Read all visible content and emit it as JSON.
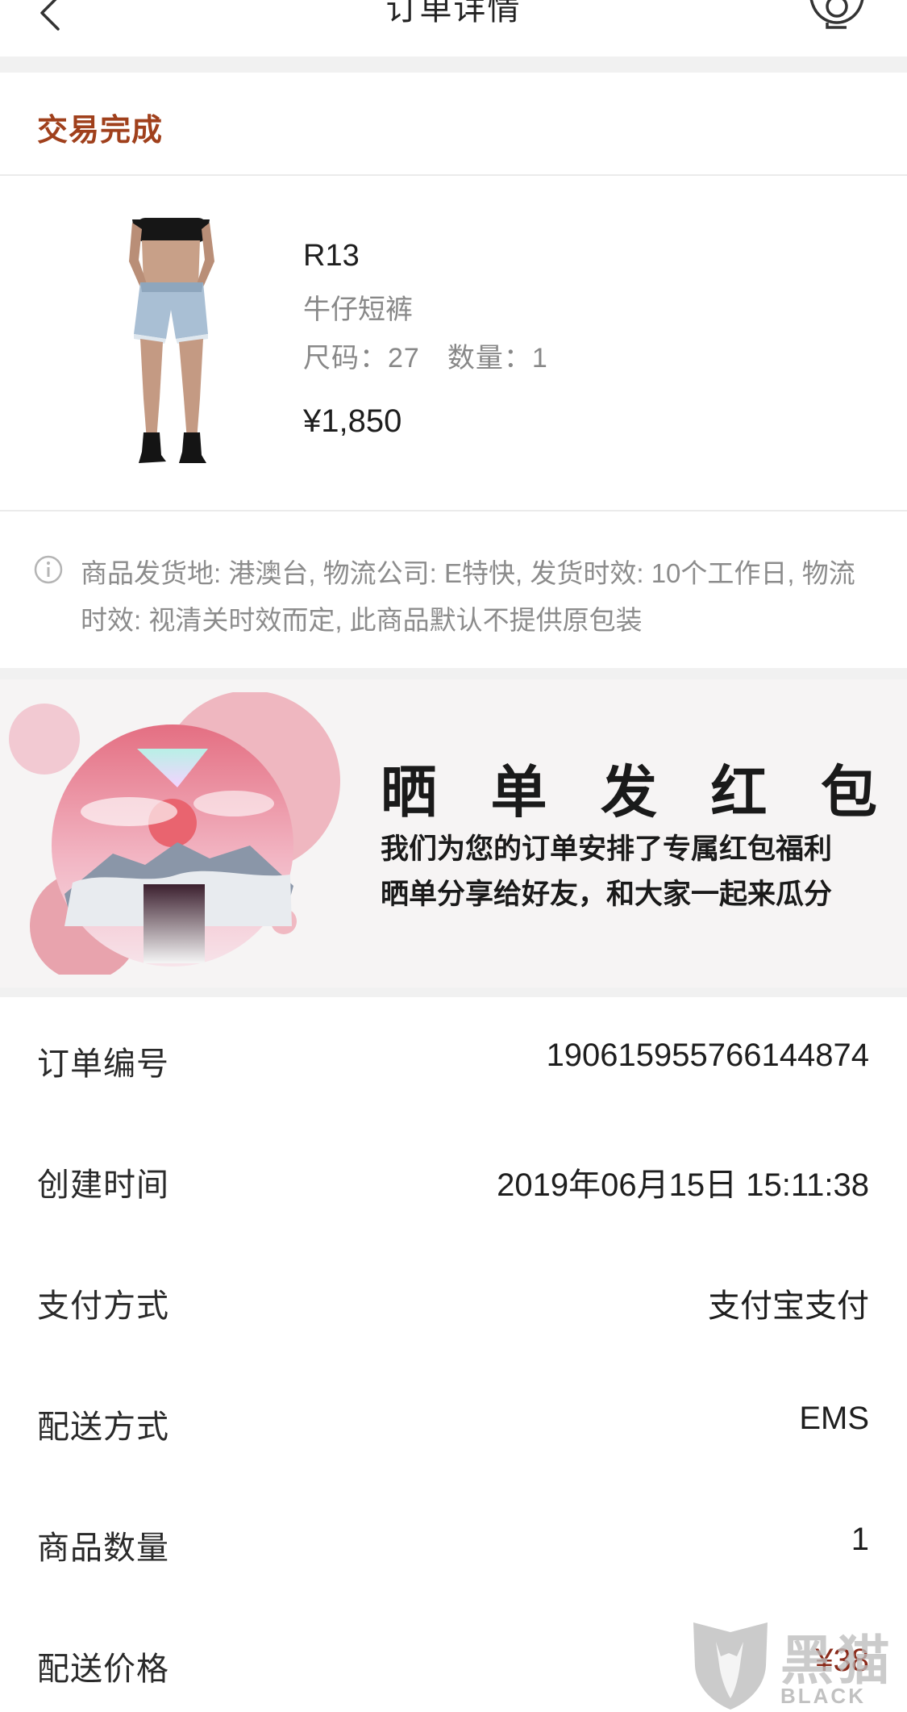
{
  "header": {
    "title": "订单详情"
  },
  "order_status": "交易完成",
  "product": {
    "brand": "R13",
    "name": "牛仔短裤",
    "size_label": "尺码：",
    "size_value": "27",
    "qty_label": "数量：",
    "qty_value": "1",
    "price": "¥1,850"
  },
  "notice": {
    "text": "商品发货地: 港澳台, 物流公司: E特快, 发货时效: 10个工作日, 物流时效: 视清关时效而定, 此商品默认不提供原包装"
  },
  "promo": {
    "title_chars": [
      "晒",
      "单",
      "发",
      "红",
      "包"
    ],
    "line1": "我们为您的订单安排了专属红包福利",
    "line2": "晒单分享给好友，和大家一起来瓜分"
  },
  "details": [
    {
      "label": "订单编号",
      "value": "19061595576614487​4"
    },
    {
      "label": "创建时间",
      "value": "2019年06月15日 15:11:38"
    },
    {
      "label": "支付方式",
      "value": "支付宝支付"
    },
    {
      "label": "配送方式",
      "value": "EMS"
    },
    {
      "label": "商品数量",
      "value": "1"
    },
    {
      "label": "配送价格",
      "value": "¥38"
    }
  ],
  "watermark": {
    "big": "黑猫",
    "small": "BLACK CAT"
  },
  "colors": {
    "status": "#a0401c",
    "muted": "#8c8c8c",
    "separator": "#f1f1f1",
    "promo_bg": "#f6f4f4",
    "promo_pink": "#e8a3ad"
  },
  "icons": {
    "back": "chevron-left-icon",
    "support": "headset-icon",
    "info": "info-circle-icon"
  }
}
